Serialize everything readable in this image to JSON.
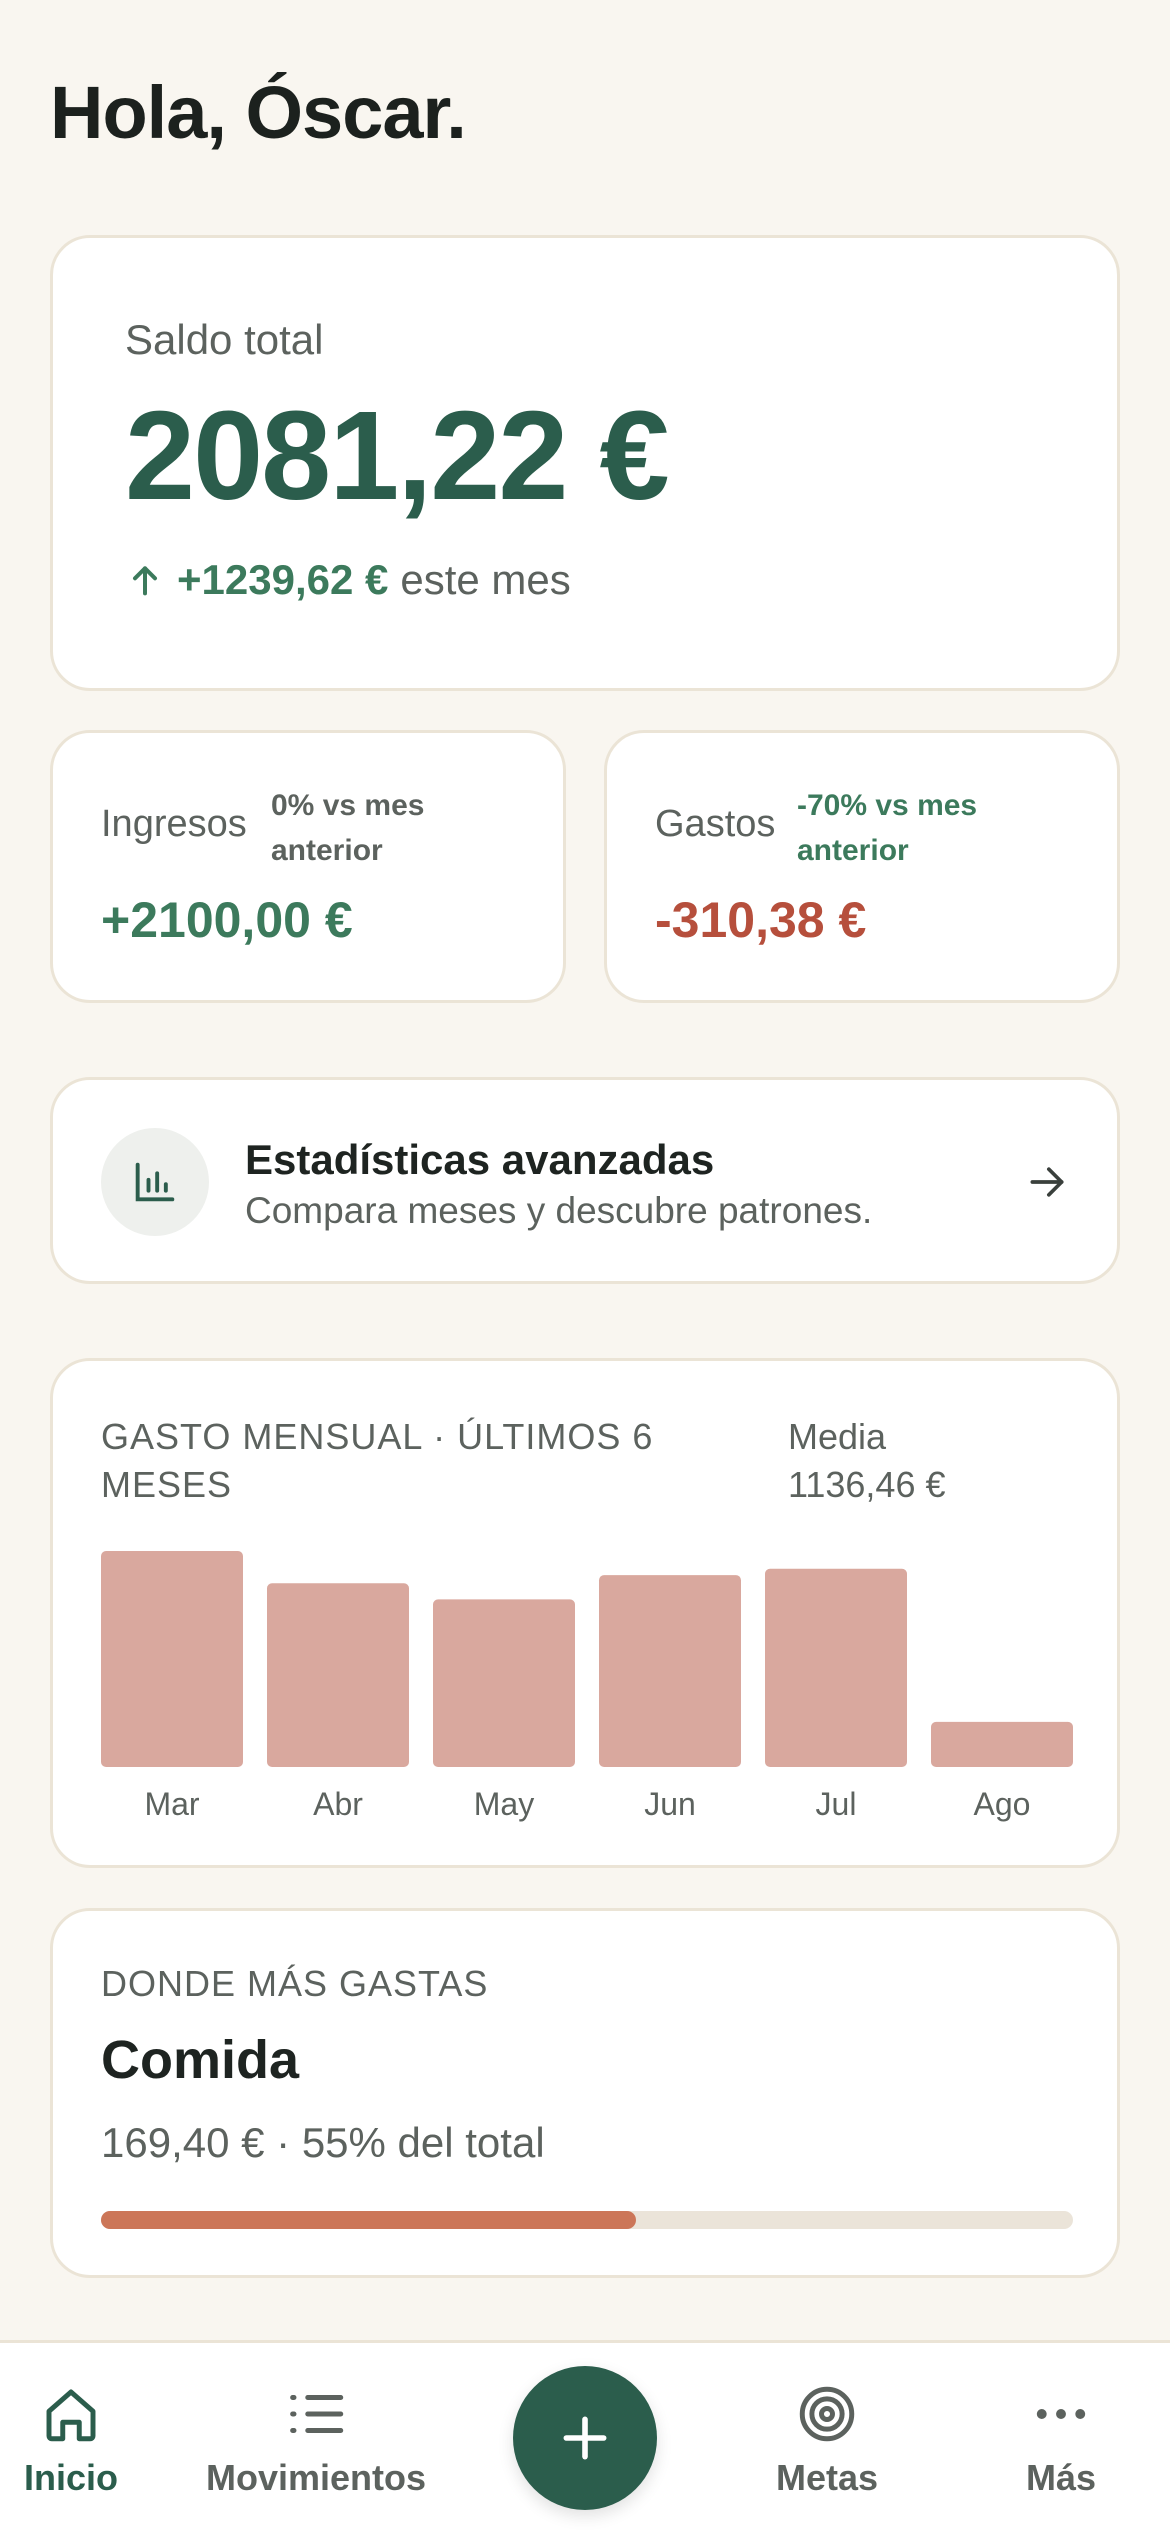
{
  "greeting": "Hola, Óscar.",
  "balance": {
    "label": "Saldo total",
    "amount": "2081,22 €",
    "delta_value": "+1239,62 €",
    "delta_suffix": "este mes",
    "arrow_icon": "arrow-up-icon"
  },
  "income": {
    "label": "Ingresos",
    "comparison": "0% vs mes anterior",
    "value": "+2100,00 €"
  },
  "expenses": {
    "label": "Gastos",
    "comparison": "-70% vs mes anterior",
    "value": "-310,38 €"
  },
  "stats_link": {
    "icon": "bar-chart-icon",
    "title": "Estadísticas avanzadas",
    "subtitle": "Compara meses y descubre patrones."
  },
  "monthly_chart": {
    "title": "GASTO MENSUAL · ÚLTIMOS 6 MESES",
    "avg_label": "Media",
    "avg_value": "1136,46 €"
  },
  "chart_data": {
    "type": "bar",
    "title": "GASTO MENSUAL · ÚLTIMOS 6 MESES",
    "categories": [
      "Mar",
      "Abr",
      "May",
      "Jun",
      "Jul",
      "Ago"
    ],
    "values": [
      1340,
      1140,
      1040,
      1190,
      1230,
      280
    ],
    "bar_color": "#d9a89e",
    "grid": false
  },
  "top_category": {
    "label": "DONDE MÁS GASTAS",
    "name": "Comida",
    "summary": "169,40 € · 55% del total",
    "share": 0.55,
    "fill_color": "#cc7658"
  },
  "nav": {
    "items": [
      {
        "label": "Inicio",
        "icon": "home-icon",
        "active": true
      },
      {
        "label": "Movimientos",
        "icon": "list-icon",
        "active": false
      },
      {
        "label": "Metas",
        "icon": "target-icon",
        "active": false
      },
      {
        "label": "Más",
        "icon": "more-icon",
        "active": false
      }
    ],
    "fab_icon": "plus-icon"
  },
  "colors": {
    "background": "#f9f6f0",
    "primary": "#2b5d4c",
    "positive": "#3c7a5c",
    "negative": "#b64f3c"
  }
}
